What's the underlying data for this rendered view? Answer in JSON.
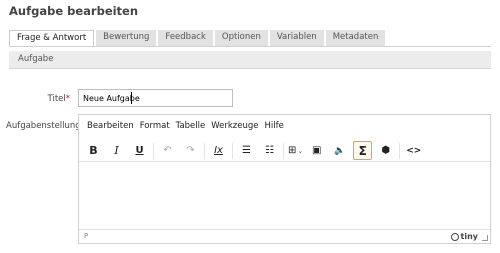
{
  "page": {
    "title": "Aufgabe bearbeiten"
  },
  "tabs": [
    {
      "label": "Frage & Antwort",
      "active": true
    },
    {
      "label": "Bewertung"
    },
    {
      "label": "Feedback"
    },
    {
      "label": "Optionen"
    },
    {
      "label": "Variablen"
    },
    {
      "label": "Metadaten"
    }
  ],
  "section": {
    "label": "Aufgabe"
  },
  "form": {
    "title_label": "Titel",
    "required_mark": "*",
    "title_value": "Neue Aufgabe",
    "task_label": "Aufgabenstellung"
  },
  "editor": {
    "menu": [
      "Bearbeiten",
      "Format",
      "Tabelle",
      "Werkzeuge",
      "Hilfe"
    ],
    "toolbar": {
      "bold": "B",
      "italic": "I",
      "underline": "U",
      "undo": "↶",
      "redo": "↷",
      "clear_format": "Ix",
      "bullet_list": "☰",
      "numbered_list": "☷",
      "table": "⊞",
      "table_chevron": "⌄",
      "image": "▣",
      "media": "🔈",
      "formula": "Σ",
      "cube": "⬢",
      "code": "<>"
    },
    "status_path": "P",
    "brand": "tiny"
  },
  "colors": {
    "accent_active_button": "#e8a33a",
    "tab_inactive": "#e2e2e2",
    "required": "#b22222"
  }
}
